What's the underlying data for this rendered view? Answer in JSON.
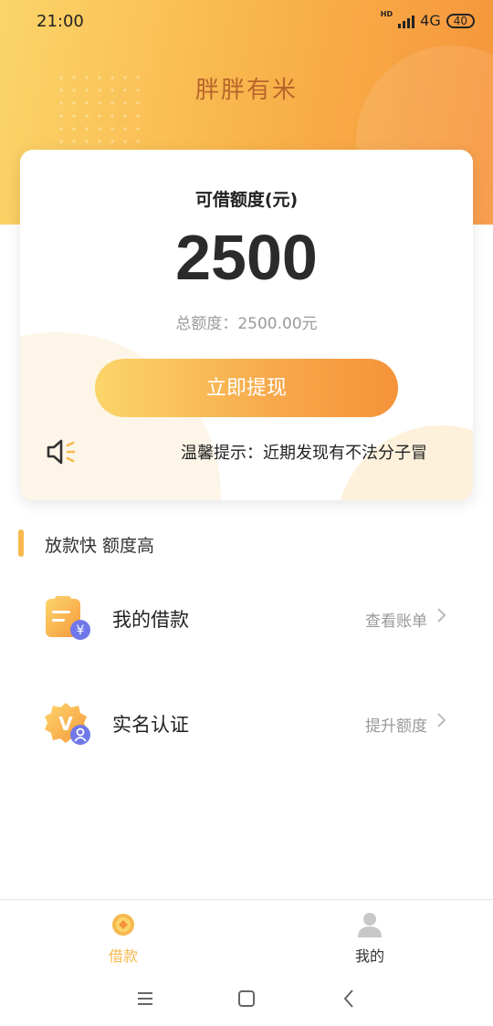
{
  "status_bar": {
    "time": "21:00",
    "network": "4G",
    "battery": "40",
    "hd_label": "HD"
  },
  "app": {
    "title": "胖胖有米"
  },
  "credit_card": {
    "label": "可借额度(元)",
    "amount": "2500",
    "total": "总额度：2500.00元",
    "withdraw_button": "立即提现",
    "notice_icon": "speaker-icon",
    "notice_text": "温馨提示：近期发现有不法分子冒"
  },
  "section": {
    "title": "放款快 额度高"
  },
  "menu": [
    {
      "label": "我的借款",
      "action": "查看账单",
      "icon": "loan-document-icon"
    },
    {
      "label": "实名认证",
      "action": "提升额度",
      "icon": "verify-badge-icon"
    }
  ],
  "bottom_nav": [
    {
      "label": "借款",
      "icon": "coin-icon",
      "active": true
    },
    {
      "label": "我的",
      "icon": "user-icon",
      "active": false
    }
  ],
  "system_nav": [
    "menu-icon",
    "home-icon",
    "back-icon"
  ],
  "colors": {
    "accent": "#f7b94f",
    "accent_dark": "#f6933a",
    "title_brown": "#b9652a",
    "inactive": "#999999"
  }
}
